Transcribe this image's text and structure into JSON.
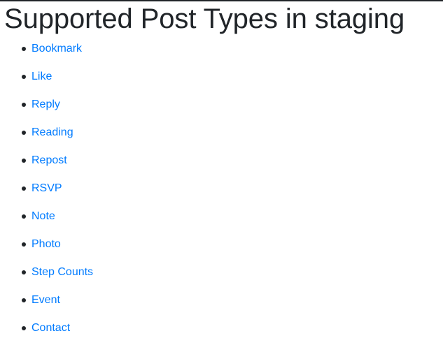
{
  "page": {
    "title": "Supported Post Types in staging",
    "post_types": [
      {
        "label": "Bookmark"
      },
      {
        "label": "Like"
      },
      {
        "label": "Reply"
      },
      {
        "label": "Reading"
      },
      {
        "label": "Repost"
      },
      {
        "label": "RSVP"
      },
      {
        "label": "Note"
      },
      {
        "label": "Photo"
      },
      {
        "label": "Step Counts"
      },
      {
        "label": "Event"
      },
      {
        "label": "Contact"
      }
    ]
  },
  "colors": {
    "link": "#007bff",
    "text": "#212529"
  }
}
